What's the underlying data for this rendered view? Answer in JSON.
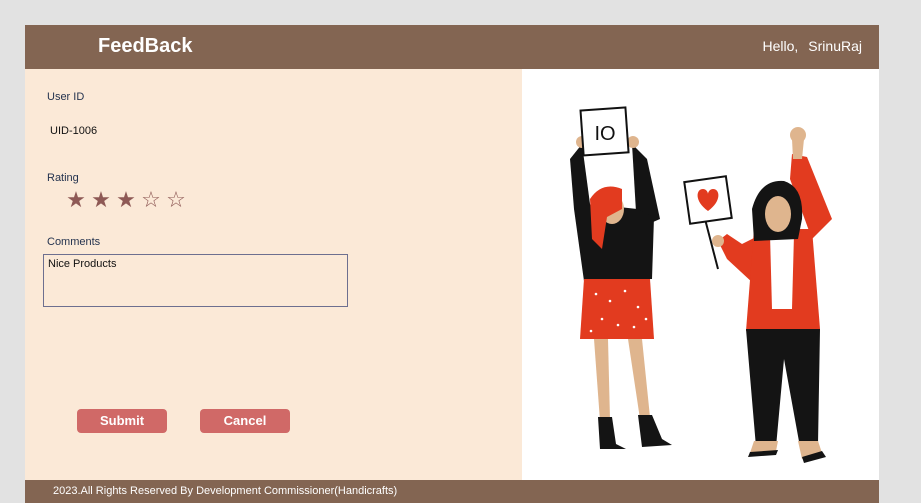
{
  "header": {
    "title": "FeedBack",
    "greeting": "Hello,",
    "user_name": "SrinuRaj"
  },
  "form": {
    "user_id_label": "User ID",
    "user_id_value": "UID-1006",
    "rating_label": "Rating",
    "rating": {
      "value": 3,
      "max": 5,
      "filled_glyph": "★",
      "empty_glyph": "☆"
    },
    "comments_label": "Comments",
    "comments_value": "Nice Products",
    "submit_label": "Submit",
    "cancel_label": "Cancel"
  },
  "illustration": {
    "sign_left_text": "IO",
    "sign_right_icon": "heart-icon"
  },
  "footer": {
    "text": "2023.All Rights Reserved By Development Commissioner(Handicrafts)"
  },
  "colors": {
    "header_bg": "#836552",
    "panel_bg": "#fbe9d7",
    "button_bg": "#d06967",
    "star_color": "#8e5955"
  }
}
